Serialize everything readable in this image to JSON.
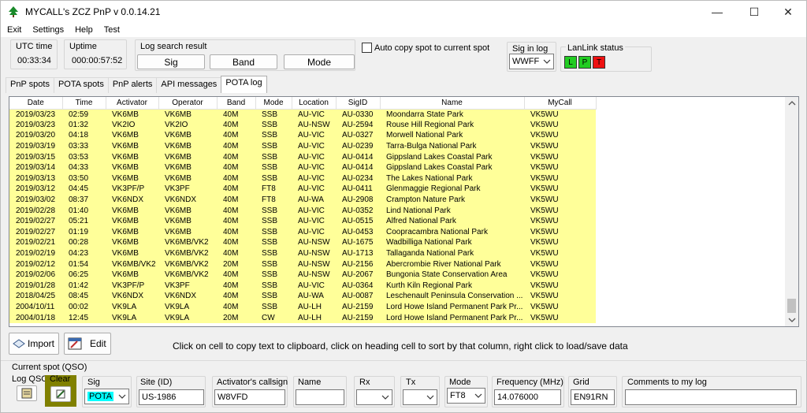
{
  "window": {
    "title": "MYCALL's ZCZ PnP v  0.0.14.21",
    "controls": {
      "minimize": "—",
      "maximize": "☐",
      "close": "✕"
    }
  },
  "menu": [
    "Exit",
    "Settings",
    "Help",
    "Test"
  ],
  "status": {
    "utc_label": "UTC time",
    "utc_value": "00:33:34",
    "uptime_label": "Uptime",
    "uptime_value": "000:00:57:52",
    "log_search_label": "Log search result",
    "search_buttons": [
      "Sig",
      "Band",
      "Mode"
    ],
    "auto_copy_label": "Auto copy spot to current spot",
    "sig_in_log_label": "Sig in log",
    "sig_in_log_value": "WWFF",
    "lanlink_label": "LanLink status",
    "lanlink_leds": [
      {
        "letter": "L",
        "color": "#22cc22"
      },
      {
        "letter": "P",
        "color": "#22cc22"
      },
      {
        "letter": "T",
        "color": "#ee1111"
      }
    ]
  },
  "tabs": [
    "PnP spots",
    "POTA spots",
    "PnP alerts",
    "API messages",
    "POTA log"
  ],
  "active_tab": "POTA log",
  "grid": {
    "columns": [
      "Date",
      "Time",
      "Activator",
      "Operator",
      "Band",
      "Mode",
      "Location",
      "SigID",
      "Name",
      "MyCall"
    ],
    "rows": [
      [
        "2019/03/23",
        "02:59",
        "VK6MB",
        "VK6MB",
        "40M",
        "SSB",
        "AU-VIC",
        "AU-0330",
        "Moondarra State Park",
        "VK5WU"
      ],
      [
        "2019/03/23",
        "01:32",
        "VK2IO",
        "VK2IO",
        "40M",
        "SSB",
        "AU-NSW",
        "AU-2594",
        "Rouse Hill Regional Park",
        "VK5WU"
      ],
      [
        "2019/03/20",
        "04:18",
        "VK6MB",
        "VK6MB",
        "40M",
        "SSB",
        "AU-VIC",
        "AU-0327",
        "Morwell National Park",
        "VK5WU"
      ],
      [
        "2019/03/19",
        "03:33",
        "VK6MB",
        "VK6MB",
        "40M",
        "SSB",
        "AU-VIC",
        "AU-0239",
        "Tarra-Bulga National Park",
        "VK5WU"
      ],
      [
        "2019/03/15",
        "03:53",
        "VK6MB",
        "VK6MB",
        "40M",
        "SSB",
        "AU-VIC",
        "AU-0414",
        "Gippsland Lakes Coastal Park",
        "VK5WU"
      ],
      [
        "2019/03/14",
        "04:33",
        "VK6MB",
        "VK6MB",
        "40M",
        "SSB",
        "AU-VIC",
        "AU-0414",
        "Gippsland Lakes Coastal Park",
        "VK5WU"
      ],
      [
        "2019/03/13",
        "03:50",
        "VK6MB",
        "VK6MB",
        "40M",
        "SSB",
        "AU-VIC",
        "AU-0234",
        "The Lakes National Park",
        "VK5WU"
      ],
      [
        "2019/03/12",
        "04:45",
        "VK3PF/P",
        "VK3PF",
        "40M",
        "FT8",
        "AU-VIC",
        "AU-0411",
        "Glenmaggie Regional Park",
        "VK5WU"
      ],
      [
        "2019/03/02",
        "08:37",
        "VK6NDX",
        "VK6NDX",
        "40M",
        "FT8",
        "AU-WA",
        "AU-2908",
        "Crampton Nature Park",
        "VK5WU"
      ],
      [
        "2019/02/28",
        "01:40",
        "VK6MB",
        "VK6MB",
        "40M",
        "SSB",
        "AU-VIC",
        "AU-0352",
        "Lind National Park",
        "VK5WU"
      ],
      [
        "2019/02/27",
        "05:21",
        "VK6MB",
        "VK6MB",
        "40M",
        "SSB",
        "AU-VIC",
        "AU-0515",
        "Alfred National Park",
        "VK5WU"
      ],
      [
        "2019/02/27",
        "01:19",
        "VK6MB",
        "VK6MB",
        "40M",
        "SSB",
        "AU-VIC",
        "AU-0453",
        "Coopracambra National Park",
        "VK5WU"
      ],
      [
        "2019/02/21",
        "00:28",
        "VK6MB",
        "VK6MB/VK2",
        "40M",
        "SSB",
        "AU-NSW",
        "AU-1675",
        "Wadbilliga National Park",
        "VK5WU"
      ],
      [
        "2019/02/19",
        "04:23",
        "VK6MB",
        "VK6MB/VK2",
        "40M",
        "SSB",
        "AU-NSW",
        "AU-1713",
        "Tallaganda National Park",
        "VK5WU"
      ],
      [
        "2019/02/12",
        "01:54",
        "VK6MB/VK2",
        "VK6MB/VK2",
        "20M",
        "SSB",
        "AU-NSW",
        "AU-2156",
        "Abercrombie River National Park",
        "VK5WU"
      ],
      [
        "2019/02/06",
        "06:25",
        "VK6MB",
        "VK6MB/VK2",
        "40M",
        "SSB",
        "AU-NSW",
        "AU-2067",
        "Bungonia State Conservation Area",
        "VK5WU"
      ],
      [
        "2019/01/28",
        "01:42",
        "VK3PF/P",
        "VK3PF",
        "40M",
        "SSB",
        "AU-VIC",
        "AU-0364",
        "Kurth Kiln Regional Park",
        "VK5WU"
      ],
      [
        "2018/04/25",
        "08:45",
        "VK6NDX",
        "VK6NDX",
        "40M",
        "SSB",
        "AU-WA",
        "AU-0087",
        "Leschenault Peninsula Conservation ...",
        "VK5WU"
      ],
      [
        "2004/10/11",
        "00:02",
        "VK9LA",
        "VK9LA",
        "40M",
        "SSB",
        "AU-LH",
        "AU-2159",
        "Lord Howe Island Permanent Park Pr...",
        "VK5WU"
      ],
      [
        "2004/01/18",
        "12:45",
        "VK9LA",
        "VK9LA",
        "20M",
        "CW",
        "AU-LH",
        "AU-2159",
        "Lord Howe Island Permanent Park Pr...",
        "VK5WU"
      ]
    ]
  },
  "actions": {
    "import_label": "Import",
    "edit_label": "Edit",
    "hint": "Click on cell  to copy text to clipboard, click on heading cell to sort by that column, right click to load/save data"
  },
  "current_spot": {
    "section_label": "Current spot (QSO)",
    "log_qso_label": "Log QSO",
    "clear_label": "Clear",
    "sig_label": "Sig",
    "sig_value": "POTA",
    "site_label": "Site (ID)",
    "site_value": "US-1986",
    "activator_label": "Activator's callsign",
    "activator_value": "W8VFD",
    "name_label": "Name",
    "name_value": "",
    "rx_label": "Rx",
    "rx_value": "",
    "tx_label": "Tx",
    "tx_value": "",
    "mode_label": "Mode",
    "mode_value": "FT8",
    "freq_label": "Frequency (MHz)",
    "freq_value": "14.076000",
    "grid_label": "Grid",
    "grid_value": "EN91RN",
    "comments_label": "Comments to my log",
    "comments_value": ""
  },
  "colors": {
    "row_bg": "#ffff99",
    "sig_highlight": "#00ffff",
    "clear_highlight": "#808000"
  }
}
